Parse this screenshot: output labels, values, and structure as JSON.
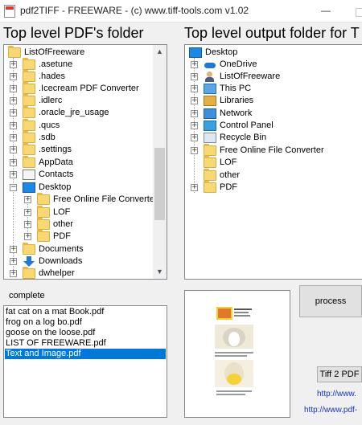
{
  "window": {
    "title": "pdf2TIFF - FREEWARE - (c) www.tiff-tools.com v1.02",
    "minimize_glyph": "—"
  },
  "pdf_panel": {
    "heading": "Top level PDF's folder",
    "tree": [
      {
        "label": "ListOfFreeware",
        "icon": "folder-icon"
      },
      {
        "label": ".asetune",
        "icon": "folder-icon"
      },
      {
        "label": ".hades",
        "icon": "folder-icon"
      },
      {
        "label": ".Icecream PDF Converter",
        "icon": "folder-icon"
      },
      {
        "label": ".idlerc",
        "icon": "folder-icon"
      },
      {
        "label": ".oracle_jre_usage",
        "icon": "folder-icon"
      },
      {
        "label": ".qucs",
        "icon": "folder-icon"
      },
      {
        "label": ".sdb",
        "icon": "folder-icon"
      },
      {
        "label": ".settings",
        "icon": "folder-icon"
      },
      {
        "label": "AppData",
        "icon": "folder-icon"
      },
      {
        "label": "Contacts",
        "icon": "contacts-icon"
      },
      {
        "label": "Desktop",
        "icon": "desktop-icon"
      },
      {
        "label": "Free Online File Converter",
        "icon": "folder-icon"
      },
      {
        "label": "LOF",
        "icon": "folder-icon"
      },
      {
        "label": "other",
        "icon": "folder-icon"
      },
      {
        "label": "PDF",
        "icon": "folder-icon"
      },
      {
        "label": "Documents",
        "icon": "documents-icon"
      },
      {
        "label": "Downloads",
        "icon": "downloads-icon"
      },
      {
        "label": "dwhelper",
        "icon": "folder-icon"
      }
    ]
  },
  "output_panel": {
    "heading": "Top level output folder for T",
    "tree": [
      {
        "label": "Desktop",
        "icon": "desktop-icon"
      },
      {
        "label": "OneDrive",
        "icon": "onedrive-icon"
      },
      {
        "label": "ListOfFreeware",
        "icon": "user-icon"
      },
      {
        "label": "This PC",
        "icon": "this-pc-icon"
      },
      {
        "label": "Libraries",
        "icon": "libraries-icon"
      },
      {
        "label": "Network",
        "icon": "network-icon"
      },
      {
        "label": "Control Panel",
        "icon": "control-panel-icon"
      },
      {
        "label": "Recycle Bin",
        "icon": "recycle-bin-icon"
      },
      {
        "label": "Free Online File Converter",
        "icon": "folder-icon"
      },
      {
        "label": "LOF",
        "icon": "folder-icon"
      },
      {
        "label": "other",
        "icon": "folder-icon"
      },
      {
        "label": "PDF",
        "icon": "folder-icon"
      }
    ]
  },
  "status": "complete",
  "files": [
    {
      "name": "fat cat on a mat Book.pdf",
      "selected": false
    },
    {
      "name": "frog on a log bo.pdf",
      "selected": false
    },
    {
      "name": "goose on the loose.pdf",
      "selected": false
    },
    {
      "name": "LIST OF FREEWARE.pdf",
      "selected": false
    },
    {
      "name": "Text and Image.pdf",
      "selected": true
    }
  ],
  "buttons": {
    "process": "process",
    "tif2pdf": "Tiff 2 PDF"
  },
  "links": {
    "link1": "http://www.",
    "link2": "http://www.pdf-"
  },
  "colors": {
    "selection": "#0078d7",
    "link": "#1a33c8"
  }
}
